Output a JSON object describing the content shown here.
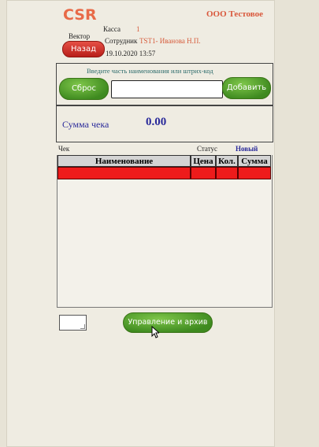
{
  "header": {
    "logo": "CSR",
    "company": "ООО Тестовое",
    "cashier_label": "Касса",
    "cashier_value": "1",
    "vector_label": "Вектор",
    "employee_label": "Сотрудник",
    "employee_value": "TST1-   Иванова Н.П.",
    "datetime": "19.10.2020  13:57"
  },
  "buttons": {
    "back": "Назад",
    "reset": "Сброс",
    "add": "Добавить",
    "archive": "Управление и архив"
  },
  "search": {
    "hint": "Введите часть наименования или штрих-код",
    "value": ""
  },
  "summary": {
    "label": "Сумма чека",
    "value": "0.00"
  },
  "check": {
    "label": "Чек",
    "status_label": "Статус",
    "status_value": "Новый"
  },
  "table": {
    "columns": [
      "Наименование",
      "Цена",
      "Кол.",
      "Сумма"
    ]
  },
  "colors": {
    "brand": "#e86a48",
    "accent_green": "#4f9a2a",
    "danger_red": "#d8241f",
    "row_selected": "#ee1b1b"
  }
}
